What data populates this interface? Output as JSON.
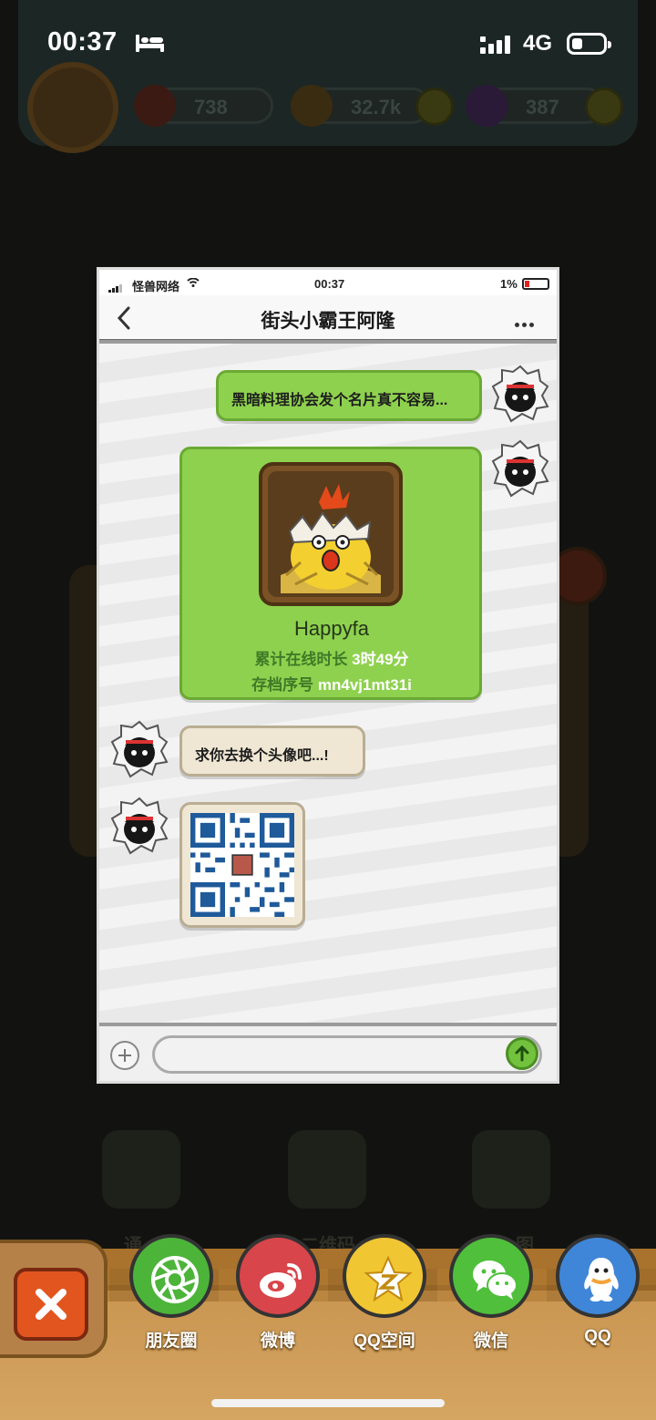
{
  "status_bar": {
    "time": "00:37",
    "network": "4G",
    "battery_level": 0.35
  },
  "background": {
    "resources": [
      {
        "name": "eye-resource",
        "value": "738",
        "color": "#3a1a12"
      },
      {
        "name": "coin-resource",
        "value": "32.7k",
        "color": "#3a2c10"
      },
      {
        "name": "potion-resource",
        "value": "387",
        "color": "#2a1a38"
      }
    ],
    "labels": [
      "通",
      "二维码",
      "图"
    ]
  },
  "shared_screenshot": {
    "status_bar": {
      "carrier": "怪兽网络",
      "time": "00:37",
      "battery": "1%"
    },
    "title": "街头小霸王阿隆",
    "messages": [
      {
        "side": "right",
        "type": "text",
        "text": "黑暗料理协会发个名片真不容易..."
      },
      {
        "side": "right",
        "type": "card",
        "name": "Happyfa",
        "online_label": "累计在线时长",
        "online_value": "3时49分",
        "save_label": "存档序号",
        "save_value": "mn4vj1mt31i"
      },
      {
        "side": "left",
        "type": "text",
        "text": "求你去换个头像吧...!"
      },
      {
        "side": "left",
        "type": "qr"
      }
    ]
  },
  "share_bar": {
    "close_icon": "close-icon",
    "targets": [
      {
        "label": "朋友圈",
        "icon": "moments-icon",
        "color": "#4db43a"
      },
      {
        "label": "微博",
        "icon": "weibo-icon",
        "color": "#d8454a"
      },
      {
        "label": "QQ空间",
        "icon": "qzone-icon",
        "color": "#f1c633"
      },
      {
        "label": "微信",
        "icon": "wechat-icon",
        "color": "#4fbf3c"
      },
      {
        "label": "QQ",
        "icon": "qq-icon",
        "color": "#3f86d8"
      }
    ]
  }
}
